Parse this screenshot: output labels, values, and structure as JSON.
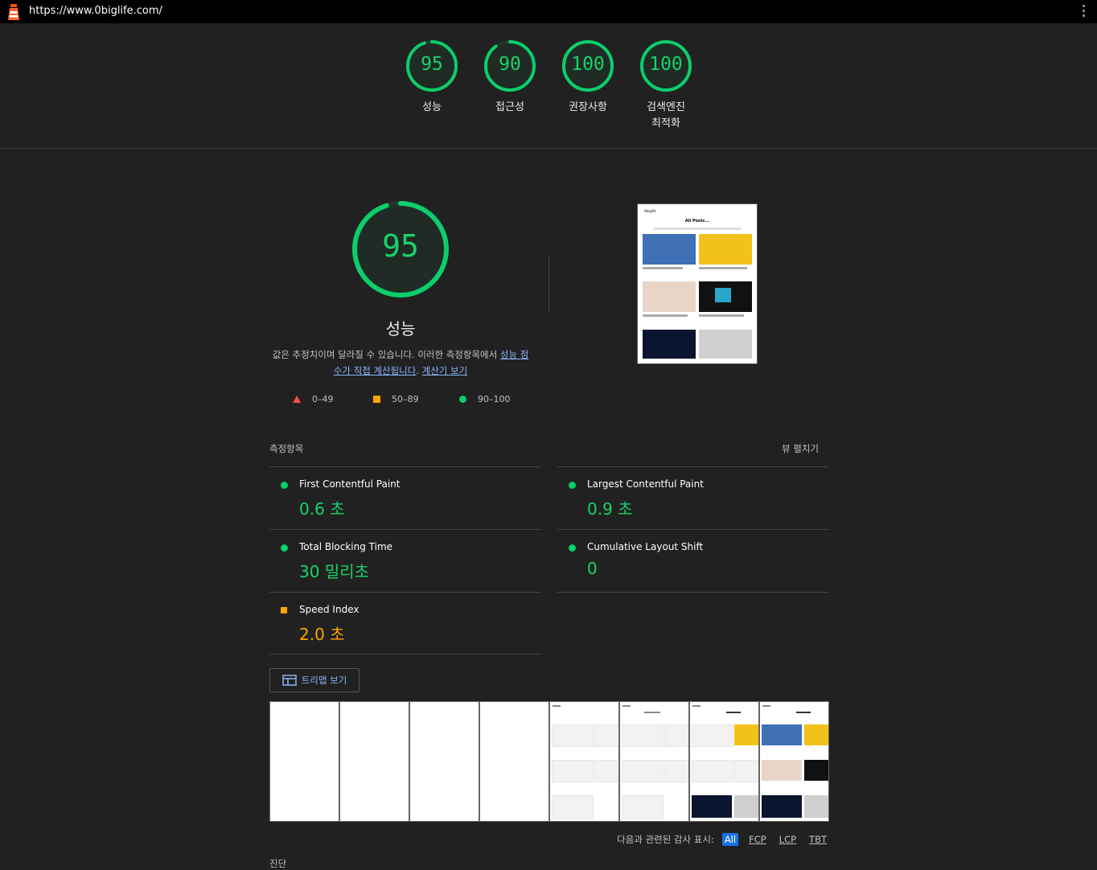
{
  "topbar": {
    "url": "https://www.0biglife.com/"
  },
  "colors": {
    "pass": "#0cce6b",
    "average": "#ffa400",
    "fail": "#ff4e42",
    "link": "#8ab4f8",
    "background": "#212121"
  },
  "gauges": [
    {
      "score": "95",
      "label": "성능",
      "level": 0.95
    },
    {
      "score": "90",
      "label": "접근성",
      "level": 0.9
    },
    {
      "score": "100",
      "label": "권장사항",
      "level": 1.0
    },
    {
      "score": "100",
      "label": "검색엔진\n최적화",
      "label_line1": "검색엔진",
      "label_line2": "최적화",
      "level": 1.0
    }
  ],
  "performance": {
    "score": "95",
    "level": 0.95,
    "title": "성능",
    "desc_text": "값은 추정치이며 달라질 수 있습니다. 이러한 측정항목에서 ",
    "desc_link1": "성능 점수가 직접 계산됩니다",
    "desc_sep": ". ",
    "desc_link2": "계산기 보기"
  },
  "legend": {
    "fail": "0–49",
    "average": "50–89",
    "pass": "90–100"
  },
  "metrics_section": {
    "title": "측정항목",
    "expand": "뷰 펼치기",
    "items": [
      {
        "name": "First Contentful Paint",
        "value": "0.6 초",
        "status": "pass"
      },
      {
        "name": "Largest Contentful Paint",
        "value": "0.9 초",
        "status": "pass"
      },
      {
        "name": "Total Blocking Time",
        "value": "30 밀리초",
        "status": "pass"
      },
      {
        "name": "Cumulative Layout Shift",
        "value": "0",
        "status": "pass"
      },
      {
        "name": "Speed Index",
        "value": "2.0 초",
        "status": "average"
      }
    ]
  },
  "treemap_button": "트리맵 보기",
  "final_screenshot": {
    "site": "0biglife",
    "heading": "All Posts..."
  },
  "filter": {
    "label": "다음과 관련된 감사 표시:",
    "chips": [
      "All",
      "FCP",
      "LCP",
      "TBT"
    ],
    "active": "All"
  },
  "diagnostics_heading": "진단"
}
